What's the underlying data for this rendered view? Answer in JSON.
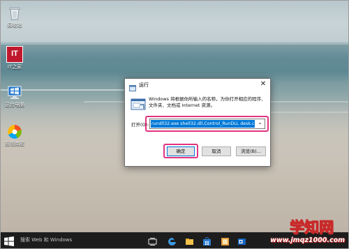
{
  "desktop": {
    "icons": [
      {
        "label": "回收站",
        "icon": "recycle-bin-icon"
      },
      {
        "label": "IT之家",
        "icon": "it-home-icon",
        "glyph": "IT"
      },
      {
        "label": "这台电脑",
        "icon": "this-pc-icon"
      },
      {
        "label": "应用商店",
        "icon": "store-icon"
      }
    ]
  },
  "dialog": {
    "title": "运行",
    "message": "Windows 将根据你所输入的名称，为你打开相应的程序、文件夹、文档或 Internet 资源。",
    "open_label": "打开(O):",
    "input_value": "rundll32.exe shell32.dll,Control_RunDLL desk.cpl,,0",
    "ok_label": "确定",
    "cancel_label": "取消",
    "browse_label": "浏览(B)...",
    "close_glyph": "✕",
    "dropdown_glyph": "⌄"
  },
  "taskbar": {
    "search_placeholder": "搜索 Web 和 Windows"
  },
  "watermark": {
    "title": "学知网",
    "url": "www.jmqz1000.com"
  },
  "colors": {
    "highlight": "#e2337f",
    "selection": "#0078d7",
    "taskbar": "#1d1d1d"
  }
}
